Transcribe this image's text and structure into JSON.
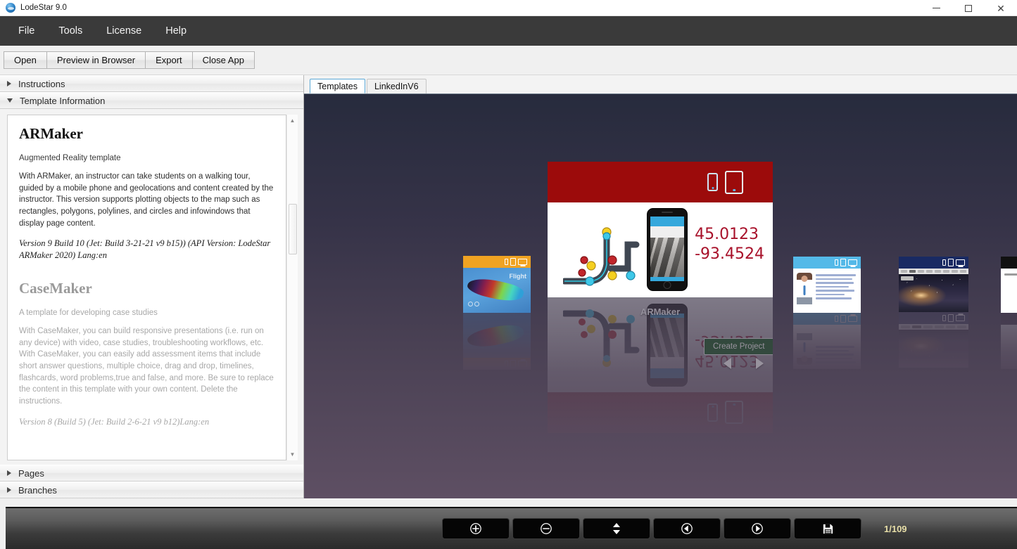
{
  "window": {
    "title": "LodeStar 9.0",
    "app_icon": "lodestar-globe-icon",
    "minimize": "minimize-icon",
    "maximize": "maximize-icon",
    "close": "close-icon"
  },
  "menubar": {
    "items": [
      {
        "label": "File"
      },
      {
        "label": "Tools"
      },
      {
        "label": "License"
      },
      {
        "label": "Help"
      }
    ]
  },
  "toolbar": {
    "buttons": [
      {
        "label": "Open"
      },
      {
        "label": "Preview in Browser"
      },
      {
        "label": "Export"
      },
      {
        "label": "Close App"
      }
    ]
  },
  "sidebar": {
    "sections": [
      {
        "label": "Instructions",
        "expanded": false,
        "arrow": "chevron-right-icon"
      },
      {
        "label": "Template Information",
        "expanded": true,
        "arrow": "chevron-down-icon"
      },
      {
        "label": "Pages",
        "expanded": false,
        "arrow": "chevron-right-icon"
      },
      {
        "label": "Branches",
        "expanded": false,
        "arrow": "chevron-right-icon"
      }
    ],
    "template_info": {
      "entries": [
        {
          "title": "ARMaker",
          "subtitle": "Augmented Reality template",
          "description": "With ARMaker, an instructor can take students on a walking tour, guided by a mobile phone and geolocations and content created by the instructor. This version supports plotting objects to the map such as rectangles, polygons, polylines, and circles and infowindows that display page content.",
          "version": "Version 9 Build 10 (Jet: Build 3-21-21 v9 b15)) (API Version: LodeStar ARMaker 2020) Lang:en"
        },
        {
          "title": "CaseMaker",
          "subtitle": "A template for developing case studies",
          "description": "With CaseMaker, you can build responsive presentations (i.e. run on any device) with video, case studies, troubleshooting workflows, etc. With CaseMaker, you can easily add assessment items that include short answer questions, multiple choice, drag and drop, timelines, flashcards, word problems,true and false, and more. Be sure to replace the content in this template with your own content. Delete the instructions.",
          "version": "Version 8 (Build 5) (Jet: Build 2-6-21 v9 b12)Lang:en"
        }
      ]
    },
    "scrollbar": {
      "up_arrow": "scroll-up-icon",
      "down_arrow": "scroll-down-icon"
    }
  },
  "main": {
    "tabs": [
      {
        "label": "Templates",
        "active": true
      },
      {
        "label": "LinkedInV6",
        "active": false
      }
    ],
    "featured_card": {
      "label": "ARMaker",
      "create_button": "Create Project",
      "coordinate_lat": "45.0123",
      "coordinate_lon": "-93.4524",
      "header_color": "#9c0b0b",
      "device_icons": [
        "phone-icon",
        "tablet-icon"
      ],
      "nav_prev": "nav-previous-arrow-icon",
      "nav_next": "nav-next-arrow-icon"
    },
    "thumbnails": [
      {
        "name": "Flight",
        "caption": "Flight",
        "bar_color": "#f0a322",
        "device_icons": [
          "phone-icon",
          "tablet-icon",
          "desktop-icon"
        ]
      },
      {
        "name": "linkedin-template",
        "caption": "",
        "bar_color": "#54b9e8",
        "device_icons": [
          "phone-icon",
          "tablet-icon",
          "desktop-icon"
        ]
      },
      {
        "name": "night-highway-template",
        "caption": "",
        "bar_color": "#192a63",
        "device_icons": [
          "phone-icon",
          "tablet-icon",
          "desktop-icon"
        ]
      },
      {
        "name": "edge-template",
        "caption": "",
        "bar_color": "#111111",
        "device_icons": []
      }
    ],
    "canvas_gradient_top": "#272b3d",
    "canvas_gradient_bottom": "#5e4f63"
  },
  "bottombar": {
    "buttons": [
      {
        "icon": "zoom-in-icon",
        "name": "zoom-in-button"
      },
      {
        "icon": "zoom-out-icon",
        "name": "zoom-out-button"
      },
      {
        "icon": "move-vertical-icon",
        "name": "reorder-button"
      },
      {
        "icon": "previous-icon",
        "name": "previous-button"
      },
      {
        "icon": "next-icon",
        "name": "next-button"
      },
      {
        "icon": "save-icon",
        "name": "save-button"
      }
    ],
    "page_counter": "1/109",
    "counter_color": "#e8dfa8"
  }
}
